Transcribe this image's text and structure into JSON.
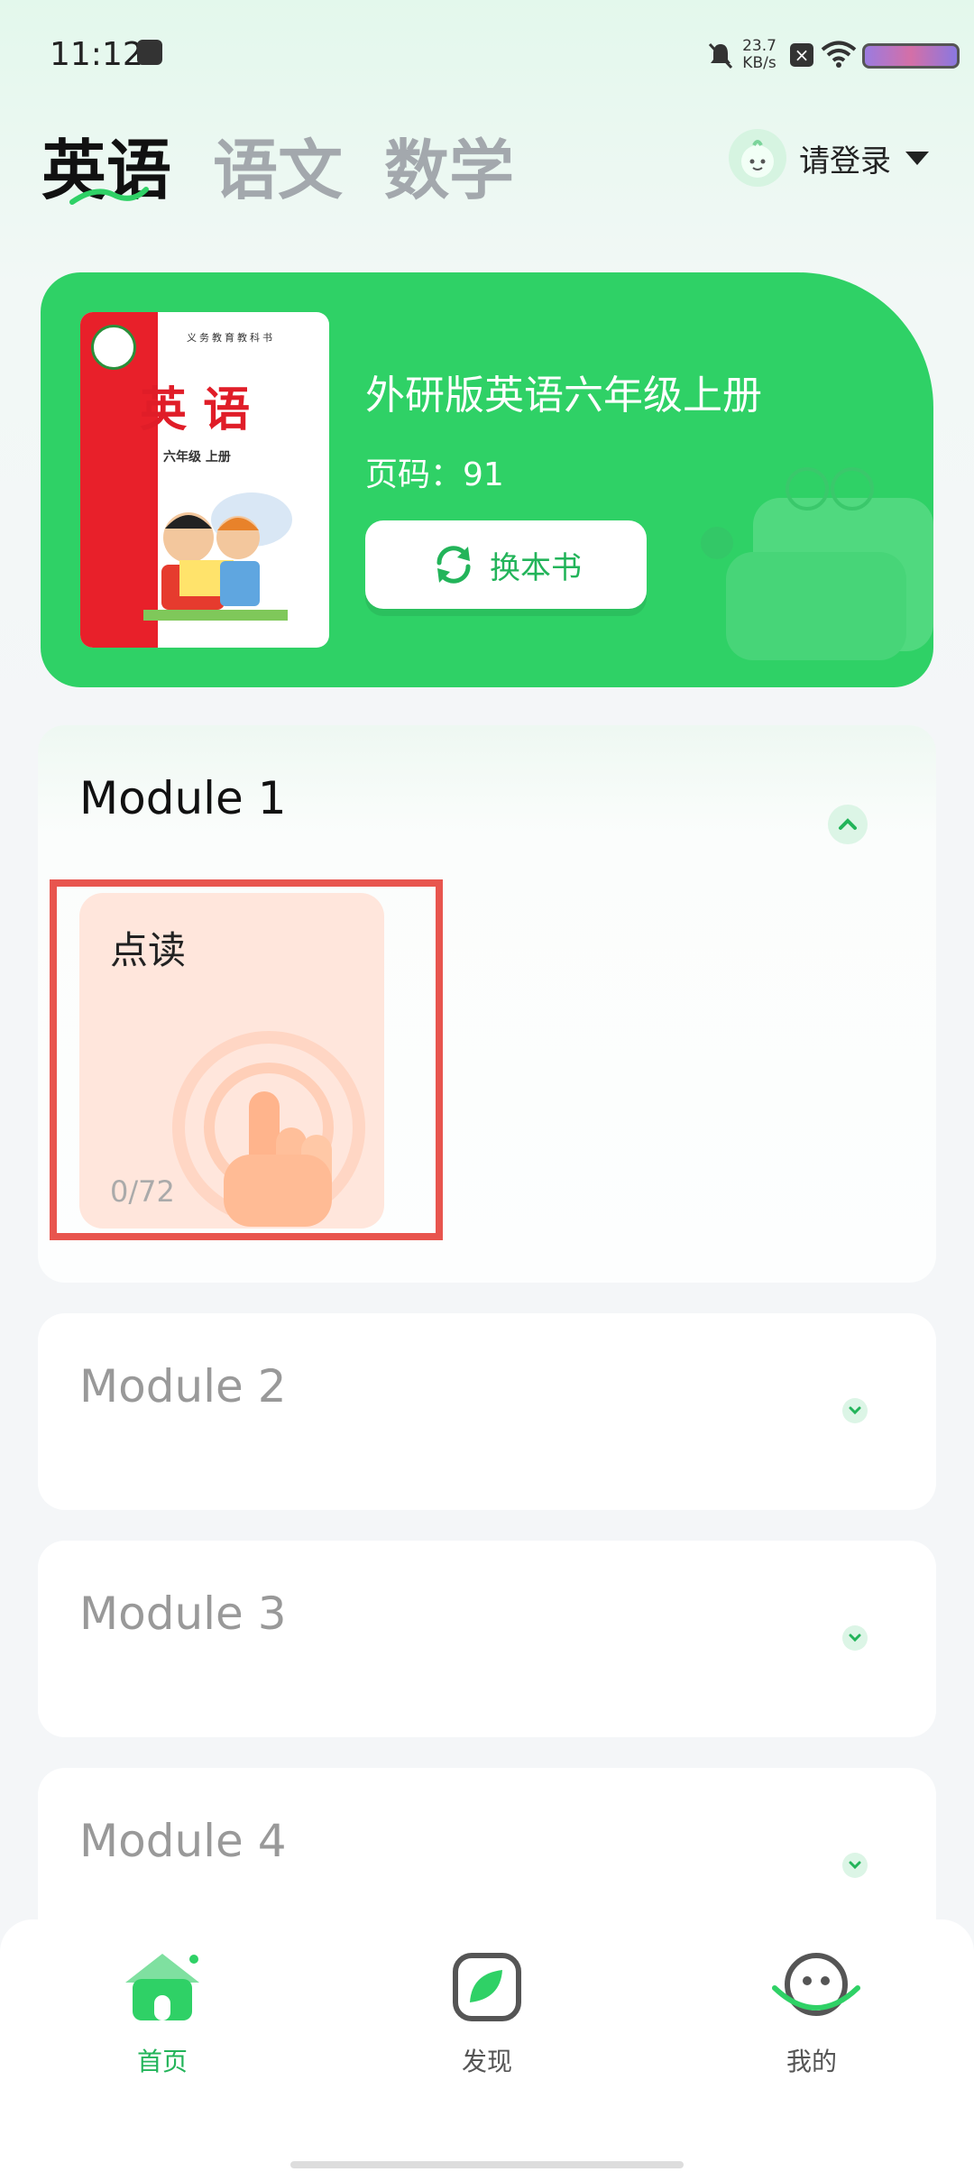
{
  "status_bar": {
    "time": "11:12",
    "net_speed_value": "23.7",
    "net_speed_unit": "KB/s",
    "icons": [
      "notification-bag-icon",
      "mute-icon",
      "close-box-icon",
      "wifi-icon",
      "battery-icon"
    ]
  },
  "tabs": [
    {
      "label": "英语",
      "active": true
    },
    {
      "label": "语文",
      "active": false
    },
    {
      "label": "数学",
      "active": false
    }
  ],
  "login": {
    "label": "请登录"
  },
  "book": {
    "title": "外研版英语六年级上册",
    "page_label": "页码：91",
    "change_button": "换本书",
    "cover": {
      "subject": "英 语",
      "grade": "六年级 上册",
      "series": "义务教育教科书"
    }
  },
  "modules": [
    {
      "title": "Module 1",
      "expanded": true
    },
    {
      "title": "Module 2",
      "expanded": false
    },
    {
      "title": "Module 3",
      "expanded": false
    },
    {
      "title": "Module 4",
      "expanded": false
    }
  ],
  "module1_item": {
    "title": "点读",
    "progress": "0/72"
  },
  "bottom_nav": [
    {
      "label": "首页",
      "icon": "home-icon",
      "active": true
    },
    {
      "label": "发现",
      "icon": "discover-icon",
      "active": false
    },
    {
      "label": "我的",
      "icon": "profile-icon",
      "active": false
    }
  ],
  "colors": {
    "accent": "#2fd166",
    "accent_text": "#23b45a",
    "highlight": "#e8554e",
    "item_bg": "#ffe6dc"
  }
}
